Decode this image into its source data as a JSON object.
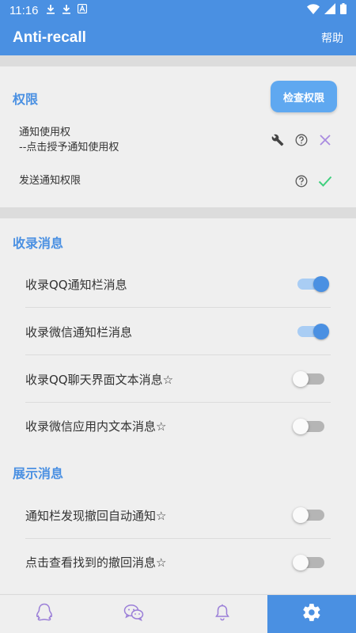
{
  "status_bar": {
    "time": "11:16",
    "icons": [
      "download-icon",
      "download-icon",
      "a-icon",
      "wifi-icon",
      "signal-icon",
      "battery-icon"
    ]
  },
  "app_bar": {
    "title": "Anti-recall",
    "help_label": "帮助"
  },
  "permissions": {
    "title": "权限",
    "check_button_label": "检查权限",
    "items": [
      {
        "line1": "通知使用权",
        "line2": "--点击授予通知使用权",
        "icons": [
          "wrench-icon",
          "help-circle-icon",
          "close-icon"
        ],
        "granted": false
      },
      {
        "line1": "发送通知权限",
        "icons": [
          "help-circle-icon",
          "check-icon"
        ],
        "granted": true
      }
    ]
  },
  "record_section": {
    "title": "收录消息",
    "items": [
      {
        "label": "收录QQ通知栏消息",
        "on": true
      },
      {
        "label": "收录微信通知栏消息",
        "on": true
      },
      {
        "label": "收录QQ聊天界面文本消息☆",
        "on": false
      },
      {
        "label": "收录微信应用内文本消息☆",
        "on": false
      }
    ]
  },
  "display_section": {
    "title": "展示消息",
    "items": [
      {
        "label": "通知栏发现撤回自动通知☆",
        "on": false
      },
      {
        "label": "点击查看找到的撤回消息☆",
        "on": false
      }
    ]
  },
  "bottom_nav": {
    "items": [
      "qq-icon",
      "wechat-icon",
      "bell-icon",
      "gear-icon"
    ],
    "active_index": 3
  },
  "colors": {
    "primary": "#4a90e2",
    "button": "#5fa8f0",
    "close": "#a98be0",
    "check": "#3fcf7d"
  }
}
